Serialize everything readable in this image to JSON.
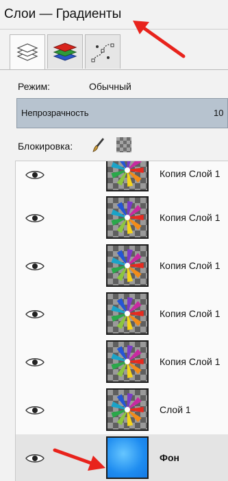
{
  "window": {
    "title": "Слои — Градиенты"
  },
  "tabs": [
    {
      "icon": "layers-icon"
    },
    {
      "icon": "channels-icon"
    },
    {
      "icon": "paths-icon"
    }
  ],
  "mode": {
    "label": "Режим:",
    "value": "Обычный"
  },
  "opacity": {
    "label": "Непрозрачность",
    "value": "10"
  },
  "lock": {
    "label": "Блокировка:",
    "icons": [
      "brush-icon",
      "alpha-checker-icon"
    ]
  },
  "layers": [
    {
      "name": "Копия Слой 1",
      "thumb": "color-wheel",
      "partial": true
    },
    {
      "name": "Копия Слой 1",
      "thumb": "color-wheel"
    },
    {
      "name": "Копия Слой 1",
      "thumb": "color-wheel"
    },
    {
      "name": "Копия Слой 1",
      "thumb": "color-wheel"
    },
    {
      "name": "Копия Слой 1",
      "thumb": "color-wheel"
    },
    {
      "name": "Слой 1",
      "thumb": "color-wheel"
    },
    {
      "name": "Фон",
      "thumb": "blue-gradient",
      "selected": true,
      "bold": true
    }
  ],
  "colors": {
    "arrow": "#e8231c",
    "opacity_bar": "#b7c3cf",
    "background_layer": "#1e8cf0"
  }
}
